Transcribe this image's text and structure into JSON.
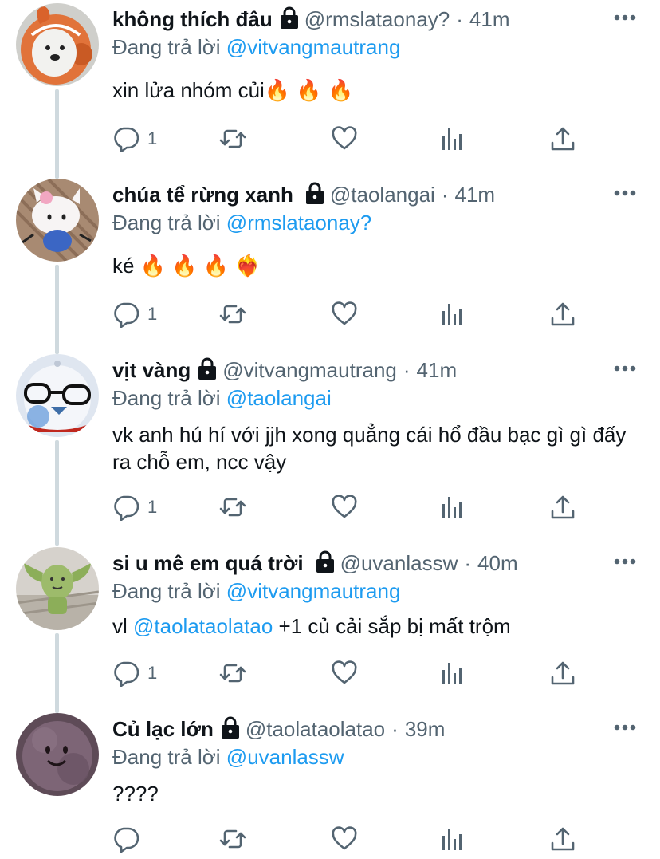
{
  "reply_prefix": "Đang trả lời",
  "colors": {
    "accent": "#1d9bf0",
    "muted": "#536471",
    "text": "#0f1419",
    "thread_line": "#cfd9de"
  },
  "tweets": [
    {
      "name": "không thích đâu",
      "handle": "@rmslataonay?",
      "time": "41m",
      "replying_to": "@vitvangmautrang",
      "text": "xin lửa nhóm củi🔥 🔥 🔥",
      "reply_count": "1",
      "avatar_icon": "bear-in-fish-costume-avatar"
    },
    {
      "name": "chúa tể rừng xanh",
      "handle": "@taolangai",
      "time": "41m",
      "replying_to": "@rmslataonay?",
      "text": "ké 🔥 🔥 🔥 ❤️‍🔥",
      "reply_count": "1",
      "avatar_icon": "hello-kitty-plush-avatar"
    },
    {
      "name": "vịt vàng",
      "handle": "@vitvangmautrang",
      "time": "41m",
      "replying_to": "@taolangai",
      "text": "vk anh hú hí với jjh xong quẳng cái hổ đầu bạc gì gì đấy ra chỗ em, ncc vậy",
      "reply_count": "1",
      "avatar_icon": "bird-with-glasses-avatar"
    },
    {
      "name": "si u mê em quá trời",
      "handle": "@uvanlassw",
      "time": "40m",
      "replying_to": "@vitvangmautrang",
      "text_pre": "vl ",
      "text_mention": "@taolataolatao",
      "text_post": " +1 củ cải sắp bị mất trộm",
      "reply_count": "1",
      "avatar_icon": "green-toy-figure-avatar"
    },
    {
      "name": "Củ lạc lớn",
      "handle": "@taolataolatao",
      "time": "39m",
      "replying_to": "@uvanlassw",
      "text": "????",
      "reply_count": "",
      "avatar_icon": "purple-fuzzy-blob-avatar"
    }
  ]
}
